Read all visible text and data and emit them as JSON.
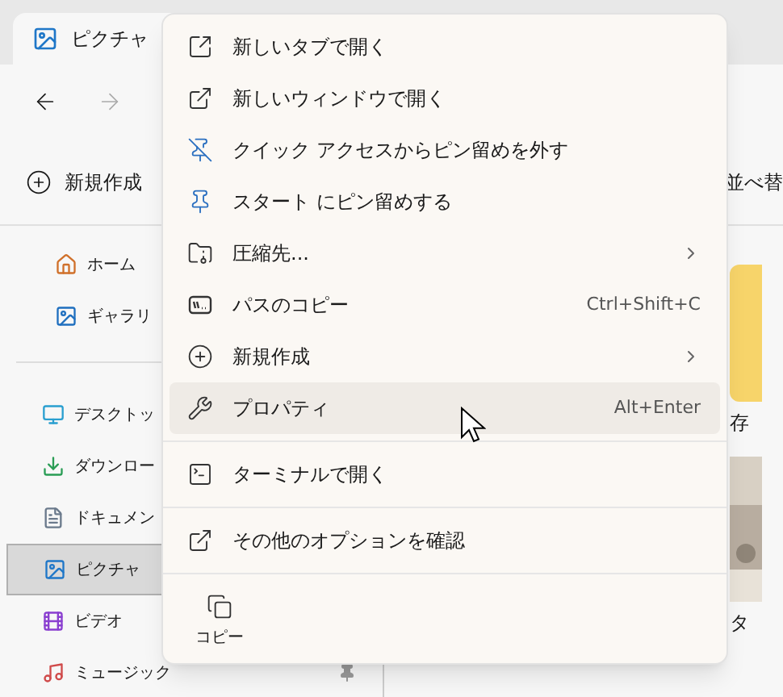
{
  "window": {
    "tab": {
      "title": "ピクチャ"
    }
  },
  "toolbar": {
    "new_button": "新規作成",
    "sort_button": "並べ替"
  },
  "sidebar": {
    "groups": [
      [
        {
          "label": "ホーム",
          "selected": false,
          "pinned": false
        },
        {
          "label": "ギャラリ",
          "selected": false,
          "pinned": false
        }
      ],
      [
        {
          "label": "デスクトッ",
          "selected": false,
          "pinned": false
        },
        {
          "label": "ダウンロー",
          "selected": false,
          "pinned": false
        },
        {
          "label": "ドキュメン",
          "selected": false,
          "pinned": false
        },
        {
          "label": "ピクチャ",
          "selected": true,
          "pinned": false
        },
        {
          "label": "ビデオ",
          "selected": false,
          "pinned": false
        },
        {
          "label": "ミュージック",
          "selected": false,
          "pinned": true
        }
      ]
    ]
  },
  "content": {
    "items": [
      {
        "label": "存"
      },
      {
        "label": "タ"
      }
    ]
  },
  "context_menu": {
    "sections": [
      [
        {
          "label": "新しいタブで開く",
          "selected": false,
          "submenu": false
        },
        {
          "label": "新しいウィンドウで開く",
          "selected": false,
          "submenu": false
        },
        {
          "label": "クイック アクセスからピン留めを外す",
          "selected": false,
          "submenu": false
        },
        {
          "label": "スタート にピン留めする",
          "selected": false,
          "submenu": false
        },
        {
          "label": "圧縮先...",
          "selected": false,
          "submenu": true
        },
        {
          "label": "パスのコピー",
          "selected": false,
          "submenu": false,
          "shortcut": "Ctrl+Shift+C"
        },
        {
          "label": "新規作成",
          "selected": false,
          "submenu": true
        },
        {
          "label": "プロパティ",
          "selected": true,
          "submenu": false,
          "shortcut": "Alt+Enter"
        }
      ],
      [
        {
          "label": "ターミナルで開く",
          "selected": false,
          "submenu": false
        }
      ],
      [
        {
          "label": "その他のオプションを確認",
          "selected": false,
          "submenu": false
        }
      ]
    ],
    "actions": [
      {
        "label": "コピー"
      }
    ]
  }
}
